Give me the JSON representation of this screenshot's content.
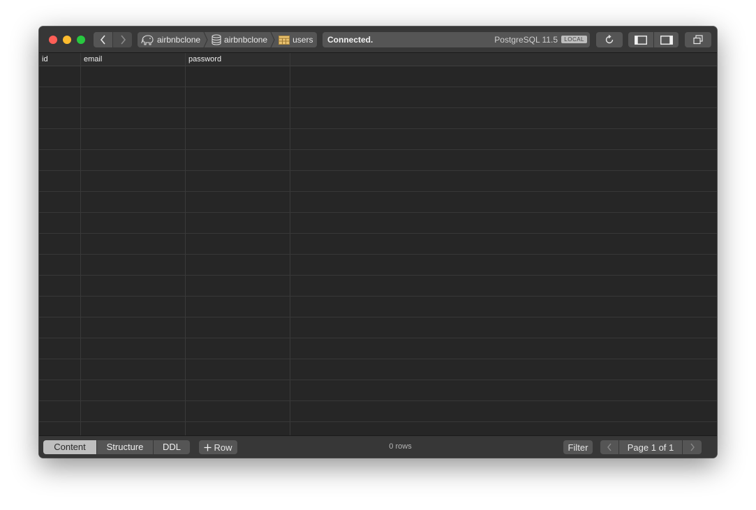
{
  "breadcrumb": {
    "server": "airbnbclone",
    "database": "airbnbclone",
    "table": "users"
  },
  "status": {
    "message": "Connected.",
    "server_version": "PostgreSQL 11.5",
    "badge": "LOCAL"
  },
  "table": {
    "columns": [
      "id",
      "email",
      "password"
    ],
    "rows": []
  },
  "bottom_bar": {
    "tabs": [
      "Content",
      "Structure",
      "DDL"
    ],
    "active_tab": "Content",
    "add_row_label": "Row",
    "row_count": "0 rows",
    "filter_label": "Filter",
    "page_label": "Page 1 of 1"
  },
  "icons": {
    "back": "chevron-left-icon",
    "forward": "chevron-right-icon",
    "server": "elephant-icon",
    "database": "database-icon",
    "table": "table-icon",
    "refresh": "refresh-icon",
    "left_panel": "sidebar-left-icon",
    "right_panel": "sidebar-right-icon",
    "window": "window-icon",
    "add": "plus-icon"
  },
  "colors": {
    "close": "#ff5f57",
    "minimize": "#febc2e",
    "zoom": "#28c840",
    "background": "#262626",
    "table_icon": "#e8c170"
  }
}
